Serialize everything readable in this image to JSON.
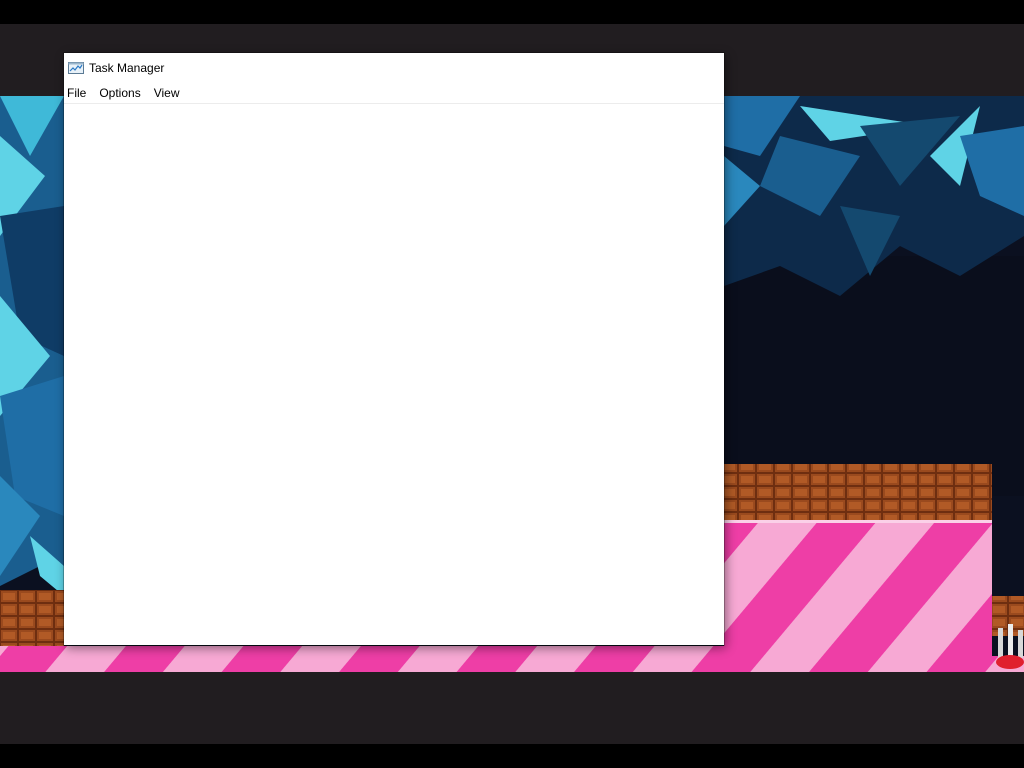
{
  "window": {
    "title": "Task Manager",
    "icon": "task-manager-icon",
    "menu": [
      {
        "label": "File"
      },
      {
        "label": "Options"
      },
      {
        "label": "View"
      }
    ]
  },
  "background": {
    "description_colors": {
      "crystal_light": "#5fd3e6",
      "crystal_mid": "#1f6ea6",
      "crystal_dark": "#0d2a4a",
      "cave_dark": "#0b1020",
      "chocolate": "#8a3f18",
      "candy_pink_light": "#f7a9d4",
      "candy_pink_dark": "#ee3ea6"
    }
  }
}
